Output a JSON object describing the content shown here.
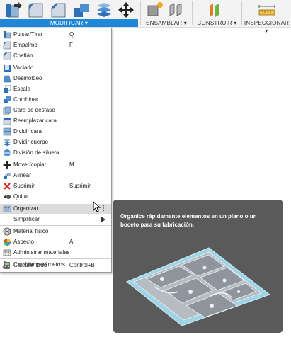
{
  "toolbar": {
    "groups": {
      "modificar": "MODIFICAR ▾",
      "ensamblar": "ENSAMBLAR ▾",
      "construir": "CONSTRUIR ▾",
      "inspeccionar": "INSPECCIONAR ▾"
    },
    "accent_color": "#1f87d6"
  },
  "menu": {
    "items": [
      {
        "label": "Pulsar/Tirar",
        "shortcut": "Q",
        "icon": "press-pull-icon"
      },
      {
        "label": "Empalme",
        "shortcut": "F",
        "icon": "fillet-icon"
      },
      {
        "label": "Chaflán",
        "shortcut": "",
        "icon": "chamfer-icon"
      },
      {
        "label": "Vaciado",
        "shortcut": "",
        "icon": "shell-icon"
      },
      {
        "label": "Desmoldeo",
        "shortcut": "",
        "icon": "draft-icon"
      },
      {
        "label": "Escala",
        "shortcut": "",
        "icon": "scale-icon"
      },
      {
        "label": "Combinar",
        "shortcut": "",
        "icon": "combine-icon"
      },
      {
        "label": "Cara de desfase",
        "shortcut": "",
        "icon": "offset-face-icon"
      },
      {
        "label": "Reemplazar cara",
        "shortcut": "",
        "icon": "replace-face-icon"
      },
      {
        "label": "Dividir cara",
        "shortcut": "",
        "icon": "split-face-icon"
      },
      {
        "label": "Dividir cuerpo",
        "shortcut": "",
        "icon": "split-body-icon"
      },
      {
        "label": "División de silueta",
        "shortcut": "",
        "icon": "silhouette-split-icon"
      },
      {
        "label": "Mover/copiar",
        "shortcut": "M",
        "icon": "move-icon"
      },
      {
        "label": "Alinear",
        "shortcut": "",
        "icon": "align-icon"
      },
      {
        "label": "Suprimir",
        "shortcut": "Suprimir",
        "icon": "delete-icon"
      },
      {
        "label": "Quitar",
        "shortcut": "",
        "icon": "remove-icon"
      },
      {
        "label": "Organizar",
        "shortcut": "",
        "icon": "arrange-icon"
      },
      {
        "label": "Simplificar",
        "shortcut": "",
        "icon": ""
      },
      {
        "label": "Material físico",
        "shortcut": "",
        "icon": "physical-material-icon"
      },
      {
        "label": "Aspecto",
        "shortcut": "A",
        "icon": "appearance-icon"
      },
      {
        "label": "Administrar materiales",
        "shortcut": "",
        "icon": "manage-materials-icon"
      },
      {
        "label": "Cambiar parámetros",
        "shortcut": "",
        "icon": "change-parameters-icon"
      },
      {
        "label": "Calcular todo",
        "shortcut": "Control+B",
        "icon": "compute-all-icon"
      }
    ]
  },
  "tooltip": {
    "text": "Organice rápidamente elementos en un plano o un boceto para su fabricación."
  }
}
